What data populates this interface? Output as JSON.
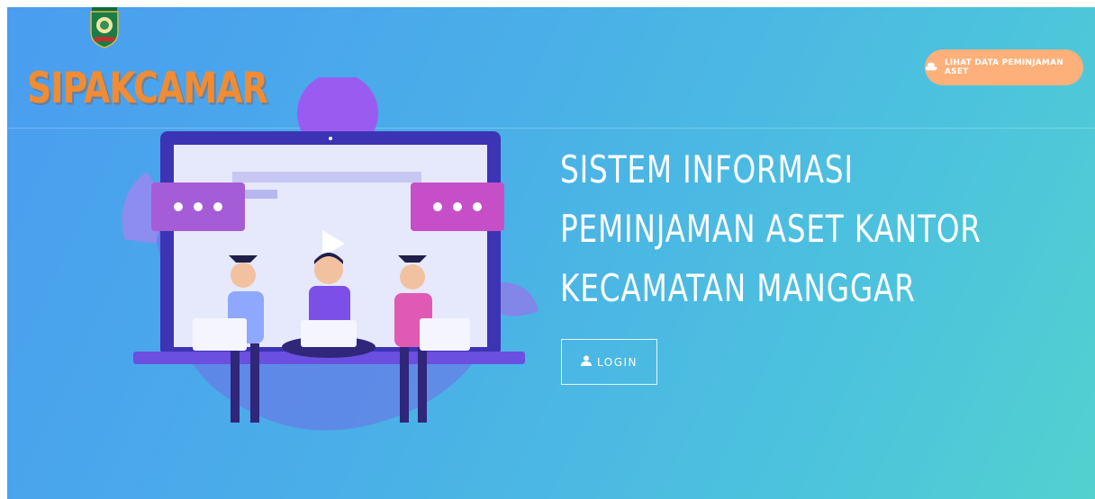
{
  "brand": {
    "name": "SIPAKCAMAR"
  },
  "header": {
    "asset_button_label": "LIHAT DATA PEMINJAMAN ASET",
    "asset_button_icon": "coins-icon"
  },
  "hero": {
    "title_lines": [
      "SISTEM INFORMASI",
      "PEMINJAMAN ASET KANTOR",
      "KECAMATAN MANGGAR"
    ],
    "login_label": "LOGIN",
    "login_icon": "user-icon"
  },
  "colors": {
    "background_start": "#4a9df0",
    "background_end": "#52d1cf",
    "asset_button": "#fdb07a",
    "brand": "#f08c33"
  }
}
